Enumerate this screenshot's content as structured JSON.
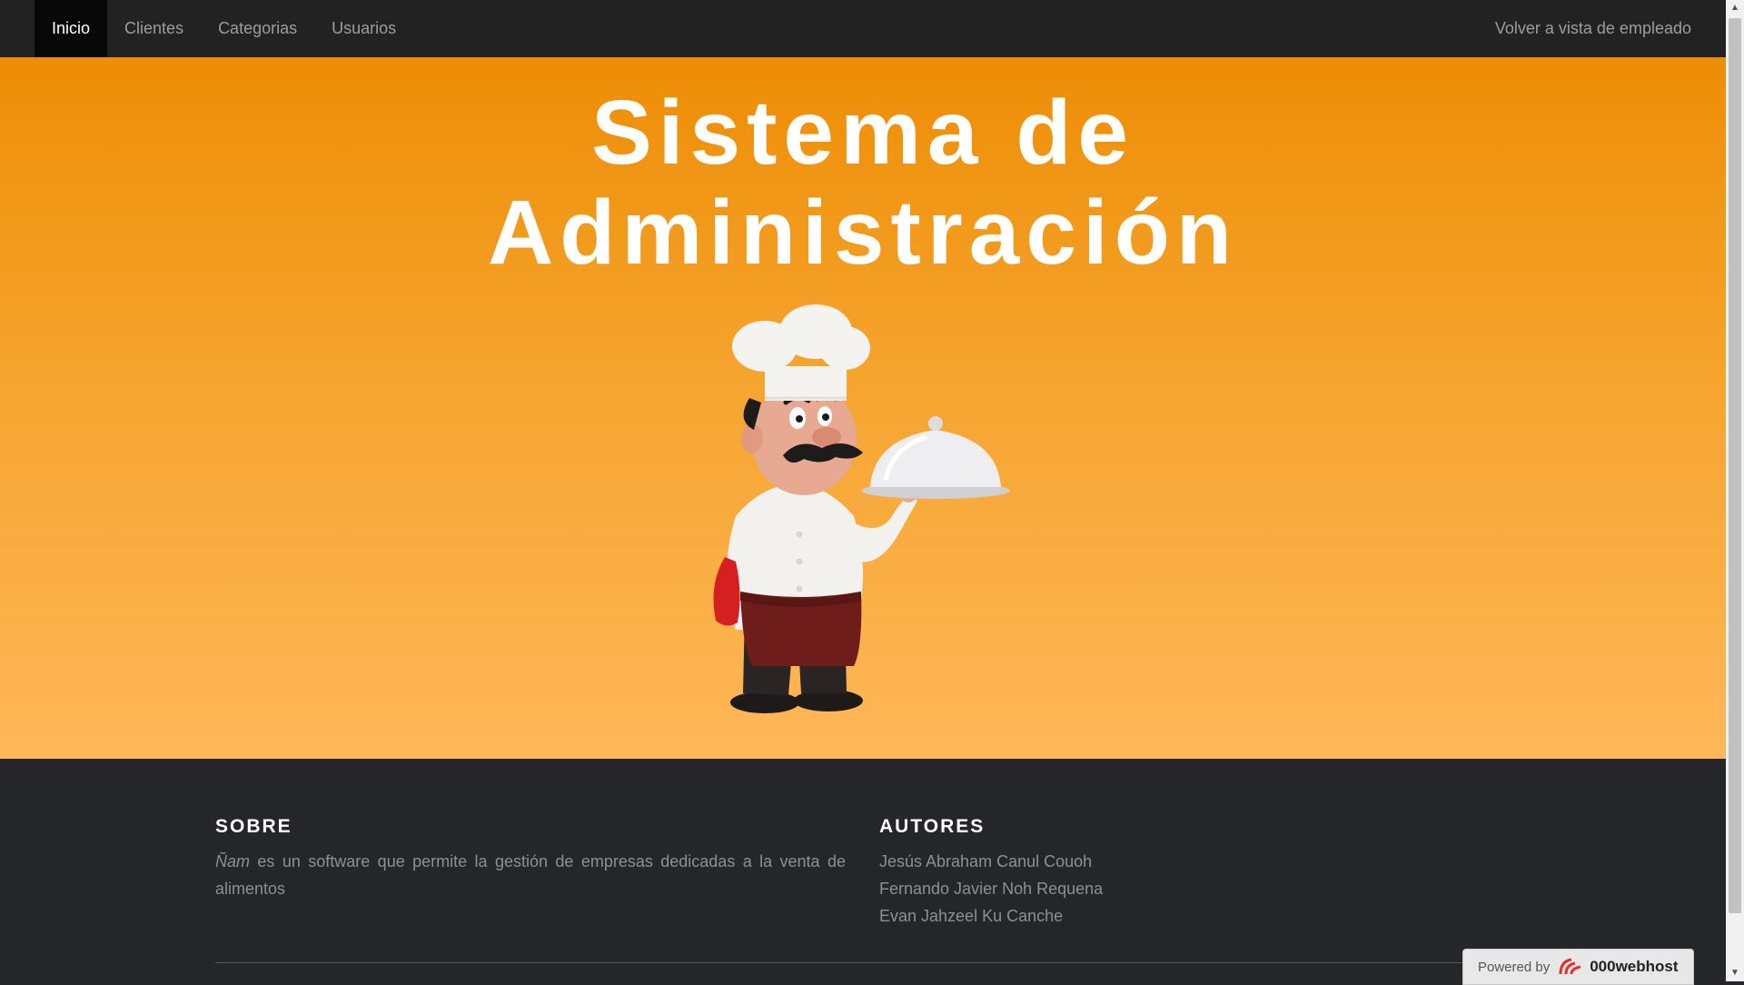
{
  "nav": {
    "items": [
      {
        "label": "Inicio",
        "active": true
      },
      {
        "label": "Clientes",
        "active": false
      },
      {
        "label": "Categorias",
        "active": false
      },
      {
        "label": "Usuarios",
        "active": false
      }
    ],
    "right_link": "Volver a vista de empleado"
  },
  "hero": {
    "title_line1": "Sistema de",
    "title_line2": "Administración",
    "illustration": "chef-holding-cloche-icon"
  },
  "footer": {
    "about": {
      "title": "SOBRE",
      "brand": "Ñam",
      "text": " es un software que permite la gestión de empresas dedicadas a la venta de alimentos"
    },
    "authors": {
      "title": "AUTORES",
      "names": [
        "Jesús Abraham Canul Couoh",
        "Fernando Javier Noh Requena",
        "Evan Jahzeel Ku Canche"
      ]
    }
  },
  "badge": {
    "prefix": "Powered by",
    "brand": "000webhost"
  },
  "colors": {
    "hero_top": "#ee8d05",
    "hero_bottom": "#ffb758",
    "navbar": "#222222",
    "footer": "#25262a"
  }
}
